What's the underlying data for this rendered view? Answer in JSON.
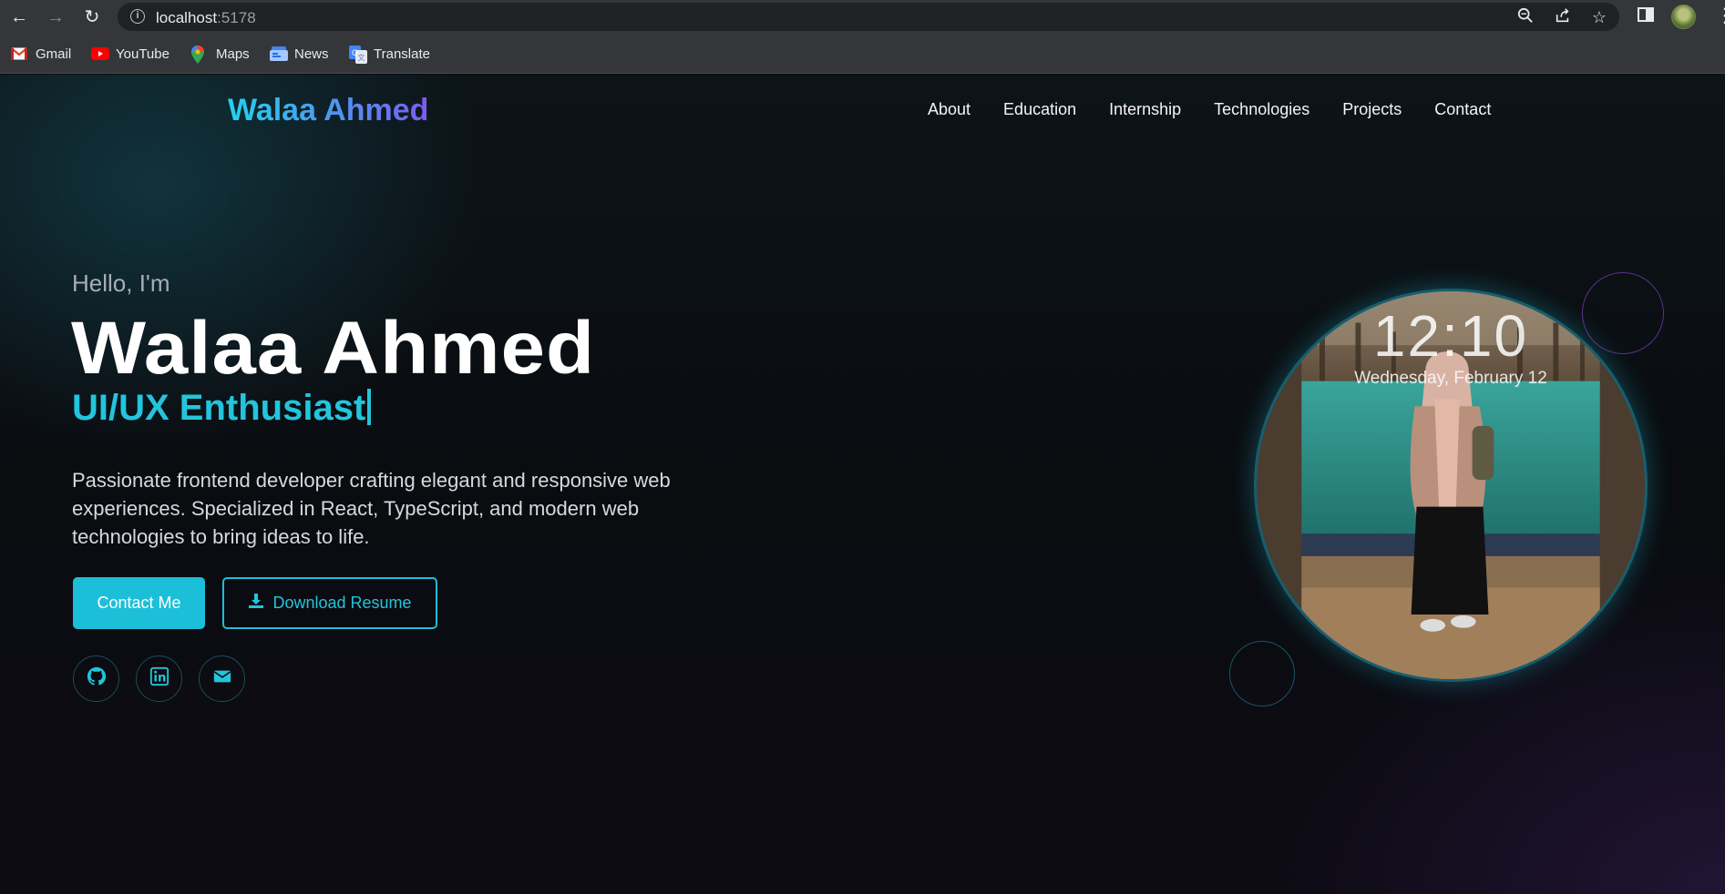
{
  "browser": {
    "url_host": "localhost",
    "url_port": ":5178",
    "bookmarks": [
      {
        "label": "Gmail",
        "icon": "gmail-icon",
        "color": "#ea4335"
      },
      {
        "label": "YouTube",
        "icon": "youtube-icon",
        "color": "#ff0000"
      },
      {
        "label": "Maps",
        "icon": "maps-icon",
        "color": "#34a853"
      },
      {
        "label": "News",
        "icon": "news-icon",
        "color": "#4285f4"
      },
      {
        "label": "Translate",
        "icon": "translate-icon",
        "color": "#4285f4"
      }
    ]
  },
  "site": {
    "logo": "Walaa Ahmed",
    "nav": [
      "About",
      "Education",
      "Internship",
      "Technologies",
      "Projects",
      "Contact"
    ]
  },
  "hero": {
    "greeting": "Hello, I'm",
    "name": "Walaa Ahmed",
    "role": "UI/UX Enthusiast",
    "description": "Passionate frontend developer crafting elegant and responsive web experiences. Specialized in React, TypeScript, and modern web technologies to bring ideas to life.",
    "contact_button": "Contact Me",
    "resume_button": "Download Resume",
    "social": [
      {
        "icon": "github-icon"
      },
      {
        "icon": "linkedin-icon"
      },
      {
        "icon": "mail-icon"
      }
    ]
  },
  "photo": {
    "clock_time": "12:10",
    "clock_date": "Wednesday, February 12"
  },
  "colors": {
    "accent": "#1cbfd8",
    "logo_gradient_start": "#22d3ee",
    "logo_gradient_end": "#7c5cf0",
    "background": "#0b0d12"
  }
}
